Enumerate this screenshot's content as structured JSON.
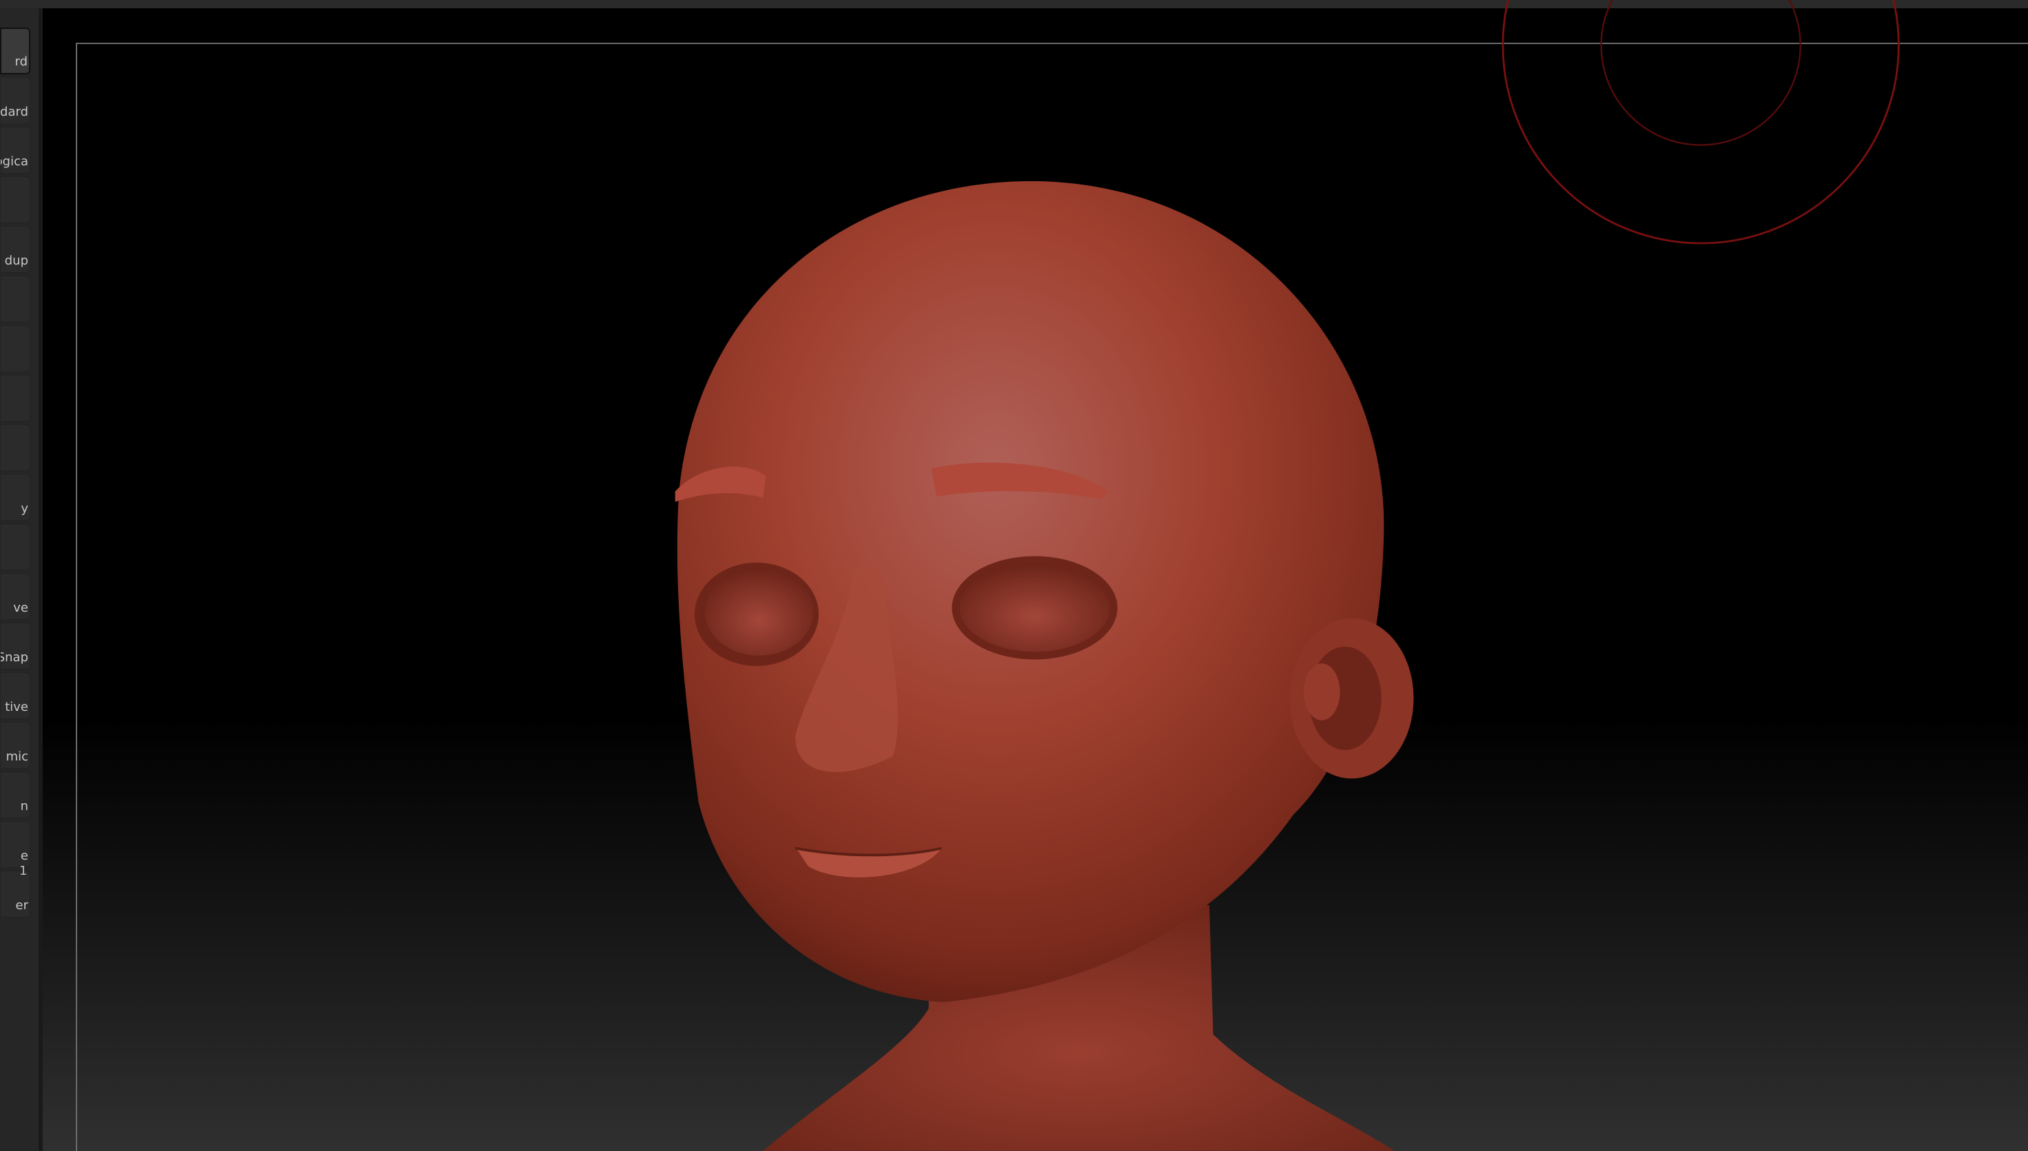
{
  "left_panel": {
    "buttons": [
      {
        "label": "rd",
        "selected": true
      },
      {
        "label": "dard"
      },
      {
        "label": "logica"
      },
      {
        "label": ""
      },
      {
        "label": "dup"
      },
      {
        "label": ""
      },
      {
        "label": ""
      },
      {
        "label": ""
      },
      {
        "label": ""
      },
      {
        "label": "y"
      },
      {
        "label": ""
      },
      {
        "label": "ve"
      },
      {
        "label": "Snap"
      },
      {
        "label": "tive"
      },
      {
        "label": "mic"
      },
      {
        "label": "n"
      },
      {
        "label": "e"
      },
      {
        "label": "er"
      }
    ],
    "counter": "1"
  },
  "colors": {
    "clay": "#a0392a",
    "brush_ring": "#7a1010"
  }
}
